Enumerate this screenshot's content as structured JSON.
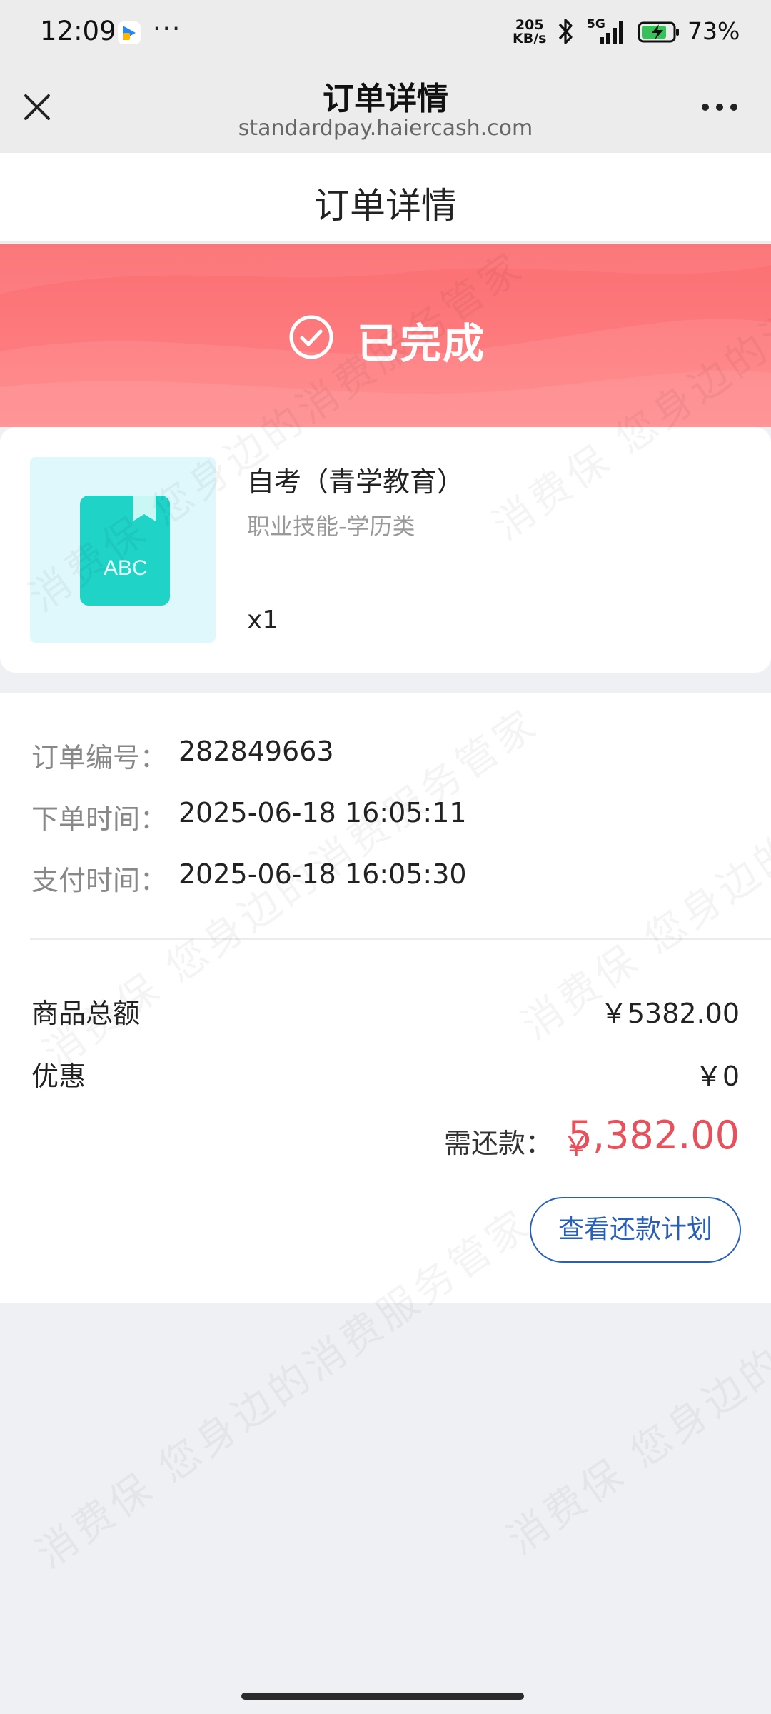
{
  "status_bar": {
    "time": "12:09",
    "dots": "···",
    "net_speed_top": "205",
    "net_speed_bottom": "KB/s",
    "network_type": "5G",
    "battery": "73%"
  },
  "browser": {
    "title": "订单详情",
    "url": "standardpay.haiercash.com"
  },
  "page": {
    "title": "订单详情",
    "status": "已完成",
    "colors": {
      "banner": "#fb6f72",
      "amount": "#e8505b",
      "button": "#2a5fb8"
    }
  },
  "product": {
    "name": "自考（青学教育）",
    "category": "职业技能-学历类",
    "quantity": "x1",
    "thumb_text": "ABC"
  },
  "order": {
    "rows": [
      {
        "label": "订单编号：",
        "value": "282849663"
      },
      {
        "label": "下单时间：",
        "value": "2025-06-18 16:05:11"
      },
      {
        "label": "支付时间：",
        "value": "2025-06-18 16:05:30"
      }
    ]
  },
  "summary": {
    "total_label": "商品总额",
    "total_value": "￥5382.00",
    "discount_label": "优惠",
    "discount_value": "￥0",
    "due_label": "需还款：",
    "due_currency": "￥",
    "due_value": "5,382.00",
    "plan_button": "查看还款计划"
  },
  "watermark": {
    "text_a": "消费保  您身边的消费服务管家"
  }
}
